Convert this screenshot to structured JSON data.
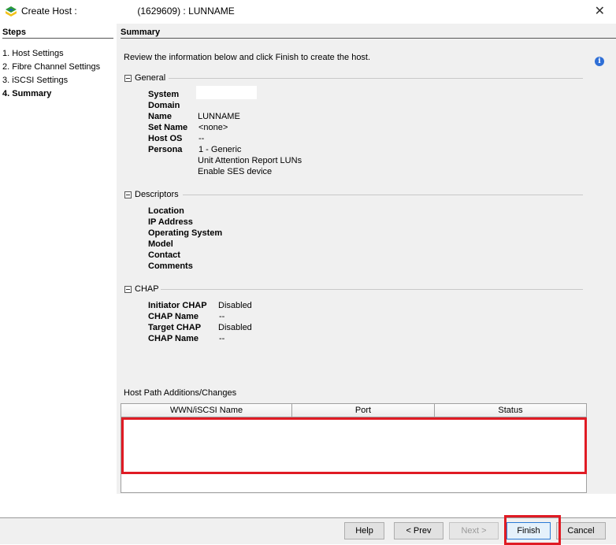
{
  "window": {
    "title_prefix": "Create Host : ",
    "title_suffix": " (1629609) : LUNNAME",
    "close_glyph": "✕"
  },
  "steps": {
    "header": "Steps",
    "items": [
      {
        "label": "1. Host Settings",
        "active": false
      },
      {
        "label": "2. Fibre Channel Settings",
        "active": false
      },
      {
        "label": "3. iSCSI Settings",
        "active": false
      },
      {
        "label": "4. Summary",
        "active": true
      }
    ]
  },
  "summary": {
    "header": "Summary",
    "intro": "Review the information below and click Finish to create the host.",
    "info_glyph": "i",
    "general": {
      "title": "General",
      "fields": [
        {
          "label": "System",
          "value": ""
        },
        {
          "label": "Domain",
          "value": ""
        },
        {
          "label": "Name",
          "value": "LUNNAME"
        },
        {
          "label": "Set Name",
          "value": "<none>"
        },
        {
          "label": "Host OS",
          "value": "--"
        },
        {
          "label": "Persona",
          "value": "1 - Generic"
        }
      ],
      "persona_extra": [
        "Unit Attention Report LUNs",
        "Enable SES device"
      ]
    },
    "descriptors": {
      "title": "Descriptors",
      "fields": [
        "Location",
        "IP Address",
        "Operating System",
        "Model",
        "Contact",
        "Comments"
      ]
    },
    "chap": {
      "title": "CHAP",
      "fields": [
        {
          "label": "Initiator CHAP",
          "value": "Disabled"
        },
        {
          "label": "CHAP Name",
          "value": "--"
        },
        {
          "label": "Target CHAP",
          "value": "Disabled"
        },
        {
          "label": "CHAP Name",
          "value": "--"
        }
      ]
    },
    "host_paths": {
      "label": "Host Path Additions/Changes",
      "columns": [
        "WWN/iSCSI Name",
        "Port",
        "Status"
      ],
      "rows": []
    }
  },
  "buttons": {
    "help": "Help",
    "prev": "< Prev",
    "next": "Next >",
    "finish": "Finish",
    "cancel": "Cancel"
  },
  "colors": {
    "highlight": "#e01b24",
    "panel_bg": "#f0f0f0"
  }
}
